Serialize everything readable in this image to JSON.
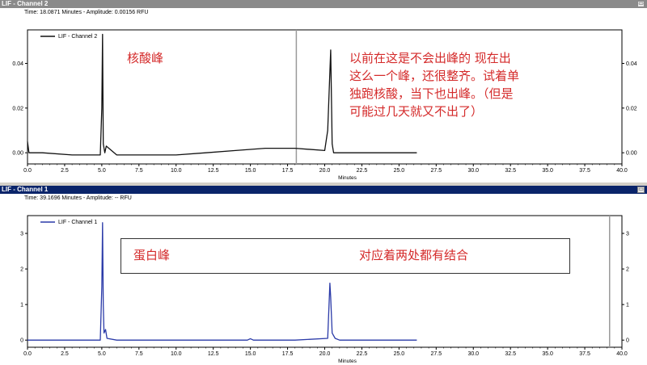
{
  "windows": [
    {
      "title": "LIF - Channel 2",
      "status": "Time: 18.0871 Minutes - Amplitude: 0.00156 RFU",
      "legend": "LIF - Channel 2",
      "colors": {
        "title_bg": "#8a8a8a",
        "trace": "#111111"
      },
      "annotations": {
        "label": "核酸峰",
        "note_lines": [
          "以前在这是不会出峰的 现在出",
          "这么一个峰，还很整齐。试着单",
          "独跑核酸，当下也出峰。（但是",
          "可能过几天就又不出了）"
        ]
      }
    },
    {
      "title": "LIF - Channel 1",
      "status": "Time: 39.1696 Minutes - Amplitude: -- RFU",
      "legend": "LIF - Channel 1",
      "colors": {
        "title_bg": "#0a246a",
        "trace": "#2a3aa8"
      },
      "annotations": {
        "label": "蛋白峰",
        "note": "对应着两处都有结合"
      }
    }
  ],
  "chart_data": [
    {
      "type": "line",
      "series": [
        {
          "name": "LIF - Channel 2",
          "x": [
            0.0,
            0.1,
            1.0,
            3.0,
            4.9,
            5.0,
            5.05,
            5.1,
            5.2,
            5.3,
            6.0,
            8.0,
            10.0,
            12.0,
            14.0,
            16.0,
            18.0,
            20.0,
            20.2,
            20.4,
            20.5,
            20.6,
            21.0,
            23.0,
            25.0,
            26.2
          ],
          "y": [
            0.005,
            0.0,
            0.0,
            -0.001,
            -0.001,
            0.02,
            0.053,
            0.004,
            0.0,
            0.003,
            -0.001,
            -0.001,
            -0.001,
            0.0,
            0.001,
            0.002,
            0.002,
            0.001,
            0.01,
            0.046,
            0.004,
            0.0,
            0.0,
            0.0,
            0.0,
            0.0
          ]
        }
      ],
      "xlabel": "Minutes",
      "xlim": [
        0,
        40
      ],
      "ylim": [
        -0.005,
        0.055
      ],
      "xticks": [
        "0.0",
        "2.5",
        "5.0",
        "7.5",
        "10.0",
        "12.5",
        "15.0",
        "17.5",
        "20.0",
        "22.5",
        "25.0",
        "27.5",
        "30.0",
        "32.5",
        "35.0",
        "37.5",
        "40.0"
      ],
      "yticks": [
        "0.00",
        "0.02",
        "0.04"
      ],
      "cursor_x": 18.09,
      "grid": false
    },
    {
      "type": "line",
      "series": [
        {
          "name": "LIF - Channel 1",
          "x": [
            0.0,
            1.0,
            3.0,
            4.9,
            5.0,
            5.05,
            5.1,
            5.15,
            5.25,
            5.35,
            6.0,
            10.0,
            14.8,
            15.0,
            15.2,
            18.0,
            20.2,
            20.35,
            20.4,
            20.5,
            20.7,
            21.0,
            23.0,
            25.0,
            26.2
          ],
          "y": [
            0.0,
            0.0,
            0.0,
            0.0,
            1.5,
            3.3,
            1.0,
            0.2,
            0.3,
            0.05,
            0.0,
            0.0,
            0.0,
            0.04,
            0.0,
            0.0,
            0.05,
            1.6,
            1.2,
            0.2,
            0.05,
            0.0,
            0.0,
            0.0,
            0.0
          ]
        }
      ],
      "xlabel": "Minutes",
      "xlim": [
        0,
        40
      ],
      "ylim": [
        -0.2,
        3.5
      ],
      "xticks": [
        "0.0",
        "2.5",
        "5.0",
        "7.5",
        "10.0",
        "12.5",
        "15.0",
        "17.5",
        "20.0",
        "22.5",
        "25.0",
        "27.5",
        "30.0",
        "32.5",
        "35.0",
        "37.5",
        "40.0"
      ],
      "yticks": [
        "0",
        "1",
        "2",
        "3"
      ],
      "cursor_x": 39.17,
      "grid": false
    }
  ]
}
